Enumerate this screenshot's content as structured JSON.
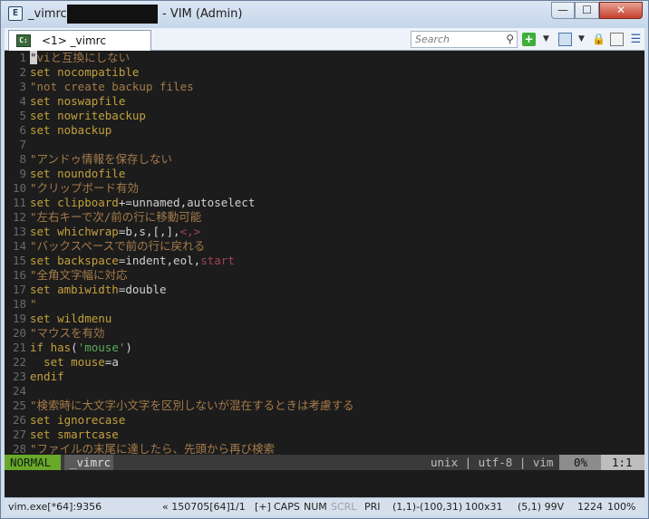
{
  "window": {
    "title_left": "_vimrc",
    "title_right": "- VIM (Admin)",
    "controls": {
      "minimize": "—",
      "maximize": "☐",
      "close": "✕"
    }
  },
  "tabbar": {
    "tab_label": "<1> _vimrc",
    "search_placeholder": "Search"
  },
  "editor": {
    "lines": [
      {
        "n": "1",
        "html": "<span class=\"cursor\">\"</span><span class=\"cm\">viと互換にしない</span>"
      },
      {
        "n": "2",
        "html": "<span class=\"kw\">set nocompatible</span>"
      },
      {
        "n": "3",
        "html": "<span class=\"cm\">\"not create backup files</span>"
      },
      {
        "n": "4",
        "html": "<span class=\"kw\">set noswapfile</span>"
      },
      {
        "n": "5",
        "html": "<span class=\"kw\">set nowritebackup</span>"
      },
      {
        "n": "6",
        "html": "<span class=\"kw\">set nobackup</span>"
      },
      {
        "n": "7",
        "html": ""
      },
      {
        "n": "8",
        "html": "<span class=\"cm\">\"アンドゥ情報を保存しない</span>"
      },
      {
        "n": "9",
        "html": "<span class=\"kw\">set noundofile</span>"
      },
      {
        "n": "10",
        "html": "<span class=\"cm\">\"クリップボード有効</span>"
      },
      {
        "n": "11",
        "html": "<span class=\"kw\">set clipboard</span>+=unnamed,autoselect"
      },
      {
        "n": "12",
        "html": "<span class=\"cm\">\"左右キーで次/前の行に移動可能</span>"
      },
      {
        "n": "13",
        "html": "<span class=\"kw\">set whichwrap</span>=b,s,[,],<span class=\"sp\">&lt;,&gt;</span>"
      },
      {
        "n": "14",
        "html": "<span class=\"cm\">\"バックスペースで前の行に戻れる</span>"
      },
      {
        "n": "15",
        "html": "<span class=\"kw\">set backspace</span>=indent,eol,<span class=\"sp\">start</span>"
      },
      {
        "n": "16",
        "html": "<span class=\"cm\">\"全角文字幅に対応</span>"
      },
      {
        "n": "17",
        "html": "<span class=\"kw\">set ambiwidth</span>=double"
      },
      {
        "n": "18",
        "html": "<span class=\"cm\">\"</span>"
      },
      {
        "n": "19",
        "html": "<span class=\"kw\">set wildmenu</span>"
      },
      {
        "n": "20",
        "html": "<span class=\"cm\">\"マウスを有効</span>"
      },
      {
        "n": "21",
        "html": "<span class=\"kw\">if has</span>(<span class=\"str\">'mouse'</span>)"
      },
      {
        "n": "22",
        "html": "  <span class=\"kw\">set mouse</span>=a"
      },
      {
        "n": "23",
        "html": "<span class=\"kw\">endif</span>"
      },
      {
        "n": "24",
        "html": ""
      },
      {
        "n": "25",
        "html": "<span class=\"cm\">\"検索時に大文字小文字を区別しないが混在するときは考慮する</span>"
      },
      {
        "n": "26",
        "html": "<span class=\"kw\">set ignorecase</span>"
      },
      {
        "n": "27",
        "html": "<span class=\"kw\">set smartcase</span>"
      },
      {
        "n": "28",
        "html": "<span class=\"cm\">\"ファイルの末尾に達したら、先頭から再び検索</span>"
      }
    ]
  },
  "statusline": {
    "mode": "NORMAL",
    "filename": "_vimrc",
    "fileinfo": "unix | utf-8 | vim",
    "percent": "0%",
    "position": "1:1"
  },
  "winstatus": {
    "process": "vim.exe[*64]:9356",
    "build": "« 150705[64]",
    "pages": "1/1",
    "plus": "[+]",
    "caps": "CAPS",
    "num": "NUM",
    "scrl": "SCRL",
    "pri": "PRI",
    "coords": "(1,1)-(100,31)",
    "size": "100x31",
    "cursor": "(5,1) 99V",
    "mem": "1224",
    "zoom": "100%"
  }
}
